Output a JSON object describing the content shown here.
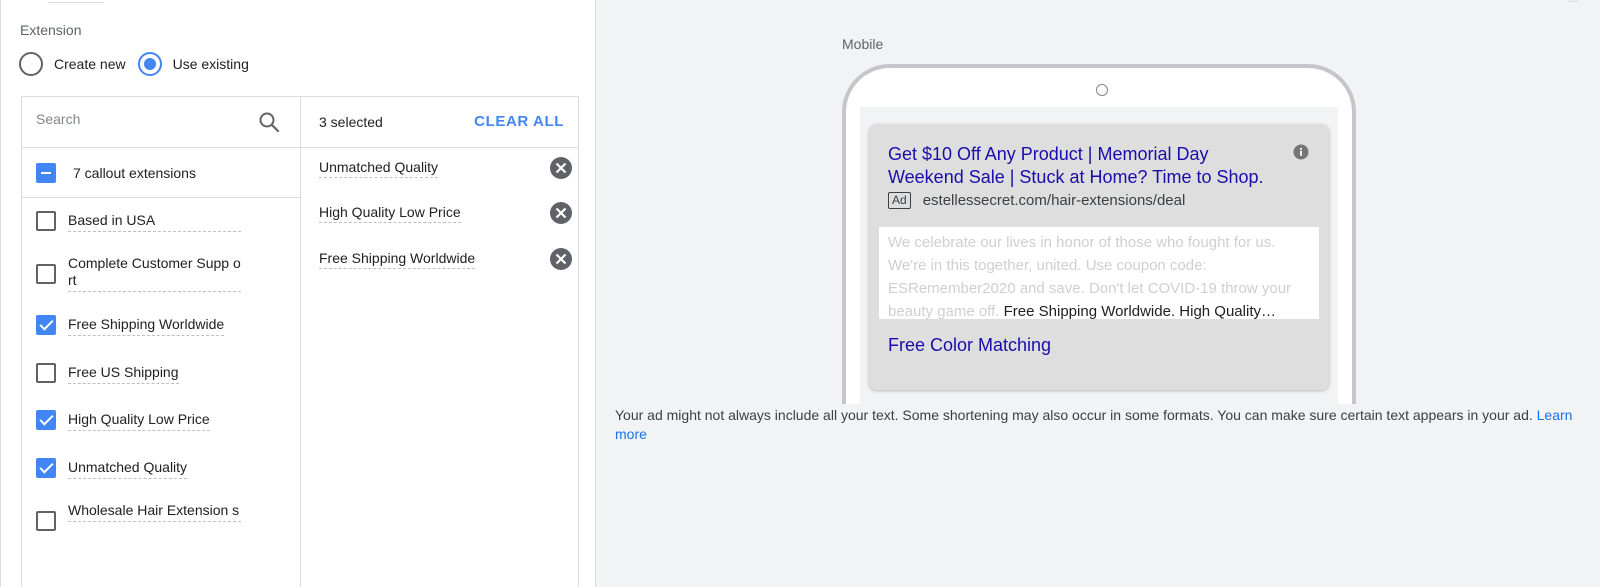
{
  "extension": {
    "label": "Extension",
    "options": [
      {
        "label": "Create new",
        "selected": false
      },
      {
        "label": "Use existing",
        "selected": true
      }
    ]
  },
  "picker": {
    "search_placeholder": "Search",
    "all_label": "7 callout extensions",
    "items": [
      {
        "label": "Based in USA",
        "checked": false
      },
      {
        "label": "Complete Customer Supp ort",
        "checked": false
      },
      {
        "label": "Free Shipping Worldwide",
        "checked": true
      },
      {
        "label": "Free US Shipping",
        "checked": false
      },
      {
        "label": "High Quality Low Price",
        "checked": true
      },
      {
        "label": "Unmatched Quality",
        "checked": true
      },
      {
        "label": "Wholesale Hair Extension s",
        "checked": false
      }
    ],
    "selected_count": "3 selected",
    "clear_all": "CLEAR ALL",
    "selected": [
      "Unmatched Quality",
      "High Quality Low Price",
      "Free Shipping Worldwide"
    ]
  },
  "preview": {
    "device_label": "Mobile",
    "ad": {
      "headline": "Get $10 Off Any Product | Memorial Day Weekend Sale | Stuck at Home? Time to Shop.",
      "badge": "Ad",
      "url": "estellessecret.com/hair-extensions/deal",
      "description": "We celebrate our lives in honor of those who fought for us. We're in this together, united. Use coupon code: ESRemember2020 and save. Don't let COVID-19 throw your beauty game off.",
      "callouts": "Free Shipping Worldwide. High Quality…",
      "sitelink": "Free Color Matching"
    },
    "disclaimer": "Your ad might not always include all your text. Some shortening may also occur in some formats. You can make sure certain text appears in your ad.",
    "learn_more": "Learn more"
  },
  "colors": {
    "accent": "#4285f4",
    "ad_link": "#1a0dab",
    "preview_bg": "#f1f3f4"
  }
}
